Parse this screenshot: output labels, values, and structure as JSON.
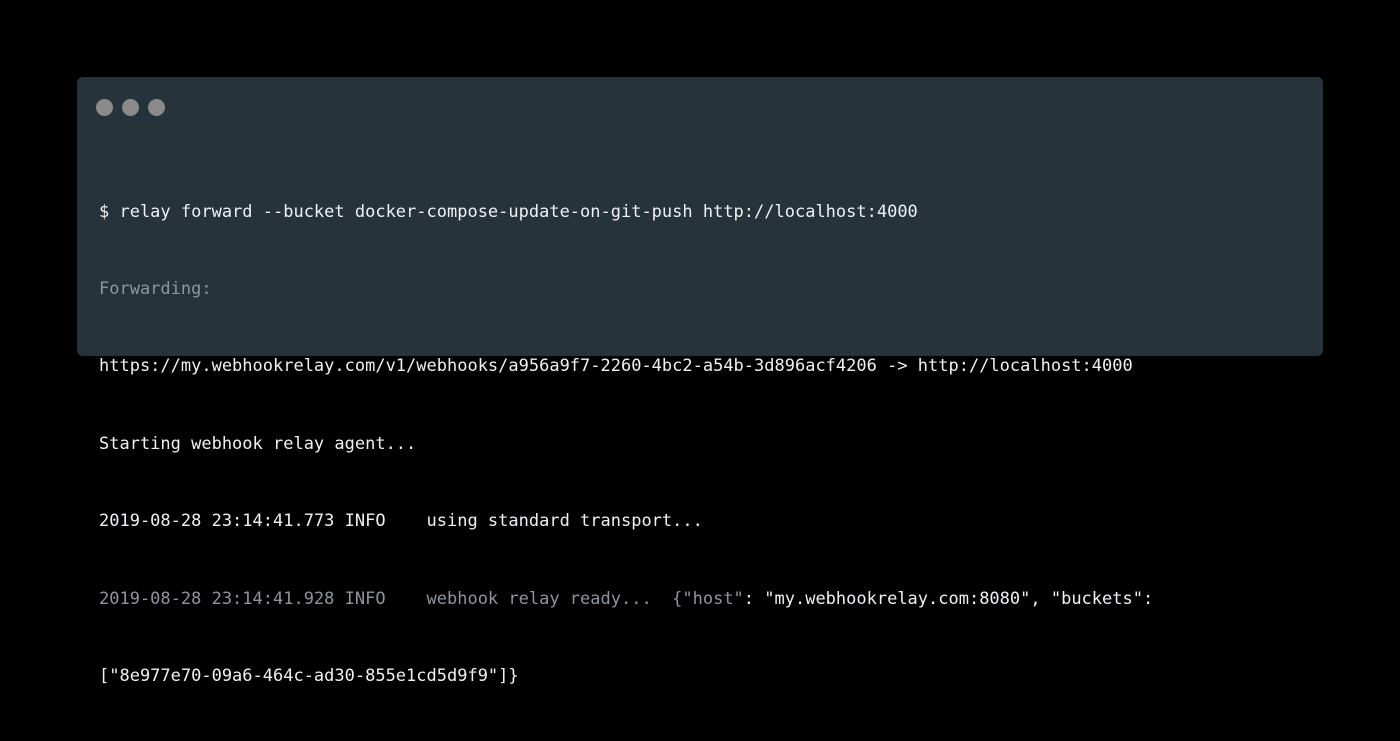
{
  "window": {
    "controls": [
      "close-dot",
      "minimize-dot",
      "maximize-dot"
    ],
    "background": "#26333a"
  },
  "terminal": {
    "line1": "$ relay forward --bucket docker-compose-update-on-git-push http://localhost:4000",
    "line2": "Forwarding:",
    "line3": "https://my.webhookrelay.com/v1/webhooks/a956a9f7-2260-4bc2-a54b-3d896acf4206 -> http://localhost:4000",
    "line4": "Starting webhook relay agent...",
    "line5": "2019-08-28 23:14:41.773 INFO    using standard transport...",
    "line6_prefix": "2019-08-28 23:14:41.928 INFO    webhook relay ready...  {\"host\"",
    "line6_rest": ": \"my.webhookrelay.com:8080\", \"buckets\":",
    "line7": "[\"8e977e70-09a6-464c-ad30-855e1cd5d9f9\"]}"
  }
}
